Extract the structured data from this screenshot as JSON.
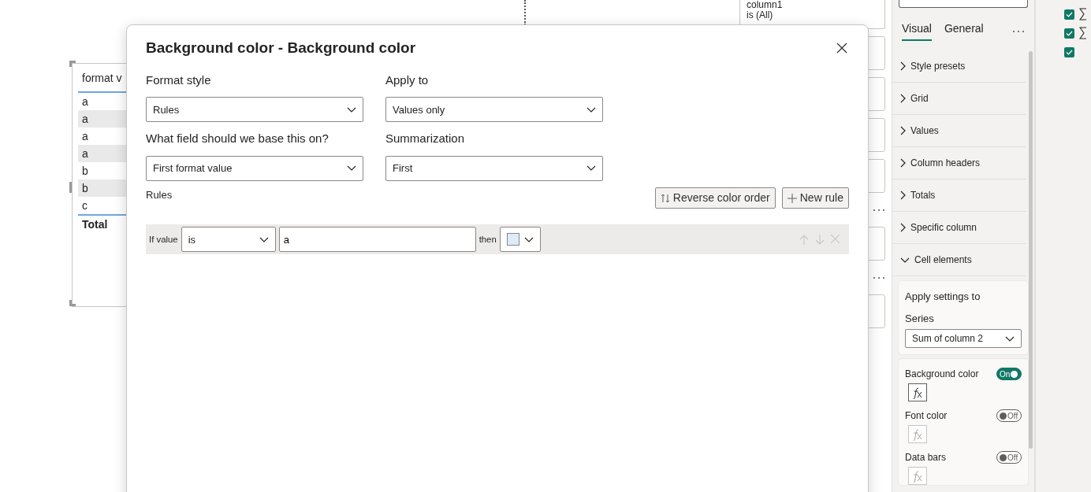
{
  "canvas": {
    "table": {
      "header": "format v",
      "rows": [
        "a",
        "a",
        "a",
        "a",
        "b",
        "b",
        "c"
      ],
      "total": "Total"
    }
  },
  "filters": [
    {
      "kind": "card",
      "lines": [
        "column1",
        "is (All)"
      ]
    },
    {
      "kind": "card"
    },
    {
      "kind": "card"
    },
    {
      "kind": "card"
    },
    {
      "kind": "card"
    },
    {
      "kind": "more"
    },
    {
      "kind": "card"
    },
    {
      "kind": "more"
    },
    {
      "kind": "card"
    }
  ],
  "dialog": {
    "title": "Background color - Background color",
    "fields": [
      {
        "label": "Format style",
        "value": "Rules"
      },
      {
        "label": "Apply to",
        "value": "Values only"
      },
      {
        "label": "What field should we base this on?",
        "value": "First format value"
      },
      {
        "label": "Summarization",
        "value": "First"
      }
    ],
    "rules_label": "Rules",
    "buttons": [
      {
        "kind": "reverse",
        "label": "Reverse color order"
      },
      {
        "kind": "add",
        "label": "New rule"
      }
    ],
    "rule": {
      "if_label": "If value",
      "operator": "is",
      "value": "a",
      "then_label": "then",
      "color": "#deecf9",
      "move_disabled": true
    }
  },
  "format_pane": {
    "tabs": [
      {
        "label": "Visual",
        "selected": true
      },
      {
        "label": "General",
        "selected": false
      }
    ],
    "sections": [
      {
        "label": "Style presets",
        "expanded": false
      },
      {
        "label": "Grid",
        "expanded": false
      },
      {
        "label": "Values",
        "expanded": false
      },
      {
        "label": "Column headers",
        "expanded": false
      },
      {
        "label": "Totals",
        "expanded": false
      },
      {
        "label": "Specific column",
        "expanded": false
      },
      {
        "label": "Cell elements",
        "expanded": true
      }
    ],
    "apply_settings": {
      "title": "Apply settings to",
      "series_label": "Series",
      "series_value": "Sum of column 2"
    },
    "toggles": [
      {
        "label": "Background color",
        "on": true,
        "state_text": "On"
      },
      {
        "label": "Font color",
        "on": false,
        "state_text": "Off"
      },
      {
        "label": "Data bars",
        "on": false,
        "state_text": "Off"
      }
    ]
  },
  "fields_pane": [
    {
      "checked": true,
      "kind": "measure"
    },
    {
      "checked": true,
      "kind": "measure"
    },
    {
      "checked": true,
      "kind": "plain"
    }
  ]
}
